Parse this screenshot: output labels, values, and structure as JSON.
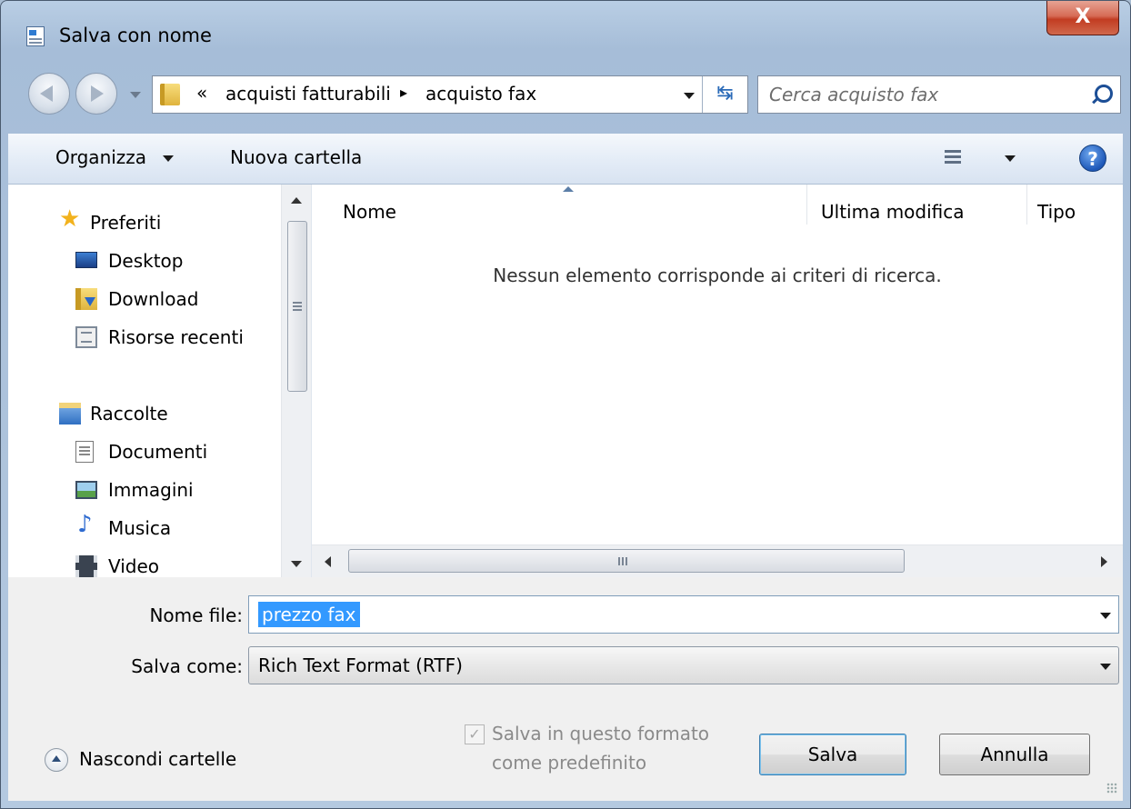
{
  "window": {
    "title": "Salva con nome",
    "close_glyph": "X"
  },
  "nav": {
    "breadcrumb_prefix": "«",
    "breadcrumb": [
      "acquisti fatturabili",
      "acquisto fax"
    ],
    "breadcrumb_separator": "▸",
    "search_placeholder": "Cerca acquisto fax",
    "refresh_glyph": "↹"
  },
  "toolbar": {
    "organize_label": "Organizza",
    "new_folder_label": "Nuova cartella",
    "help_glyph": "?"
  },
  "sidebar": {
    "items": [
      {
        "label": "Preferiti",
        "icon": "star-icon",
        "group": true
      },
      {
        "label": "Desktop",
        "icon": "desktop-icon"
      },
      {
        "label": "Download",
        "icon": "download-icon"
      },
      {
        "label": "Risorse recenti",
        "icon": "recent-places-icon"
      },
      {
        "label": "Raccolte",
        "icon": "library-icon",
        "group": true
      },
      {
        "label": "Documenti",
        "icon": "document-icon"
      },
      {
        "label": "Immagini",
        "icon": "picture-icon"
      },
      {
        "label": "Musica",
        "icon": "music-icon"
      },
      {
        "label": "Video",
        "icon": "video-icon"
      }
    ]
  },
  "filelist": {
    "columns": [
      "Nome",
      "Ultima modifica",
      "Tipo"
    ],
    "empty_message": "Nessun elemento corrisponde ai criteri di ricerca."
  },
  "form": {
    "filename_label": "Nome file:",
    "filename_value": "prezzo fax",
    "savetype_label": "Salva come:",
    "savetype_value": "Rich Text Format (RTF)",
    "default_label_line1": "Salva in questo formato",
    "default_label_line2": "come predefinito",
    "default_checked": true
  },
  "buttons": {
    "hide_folders": "Nascondi cartelle",
    "save": "Salva",
    "cancel": "Annulla"
  },
  "colors": {
    "selection": "#3399ff",
    "close_button": "#c23c22",
    "chrome": "#b4c9e0"
  }
}
